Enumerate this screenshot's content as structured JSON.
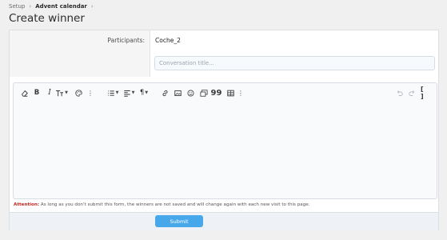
{
  "breadcrumb": {
    "items": [
      "Setup",
      "Advent calendar"
    ],
    "separator": "›"
  },
  "page_title": "Create winner",
  "form": {
    "participants_label": "Participants:",
    "participants_value": "Coche_2",
    "conversation_title_placeholder": "Conversation title...",
    "conversation_title_value": ""
  },
  "editor": {
    "toolbar_icons": [
      "eraser-icon",
      "bold-icon",
      "italic-icon",
      "text-size-icon",
      "palette-icon",
      "more-vertical-icon",
      "list-icon",
      "align-icon",
      "paragraph-icon",
      "link-icon",
      "image-icon",
      "smiley-icon",
      "media-icon",
      "quote-icon",
      "table-icon",
      "more-vertical-icon",
      "undo-icon",
      "redo-icon",
      "bbcode-icon"
    ],
    "content": ""
  },
  "attention": {
    "label": "Attention:",
    "text": "As long as you don't submit this form, the winners are not saved and will change again with each new visit to this page."
  },
  "footer": {
    "submit_label": "Submit"
  },
  "colors": {
    "accent": "#47a7eb",
    "attention": "#c0281f",
    "background": "#f0f0f1"
  }
}
